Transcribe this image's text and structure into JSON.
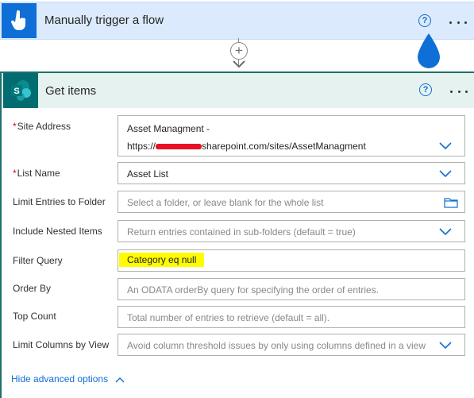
{
  "trigger": {
    "title": "Manually trigger a flow",
    "help": "?",
    "icon": "hand-touch-icon",
    "color": "#0f6fd6"
  },
  "action": {
    "title": "Get items",
    "help": "?",
    "icon": "sharepoint-icon",
    "color": "#036c70"
  },
  "fields": {
    "site_address": {
      "label": "Site Address",
      "required": "*",
      "value_line1": "Asset Managment -",
      "value_line2": "https://",
      "value_line2_tail": "sharepoint.com/sites/AssetManagment"
    },
    "list_name": {
      "label": "List Name",
      "required": "*",
      "value": "Asset List"
    },
    "limit_folder": {
      "label": "Limit Entries to Folder",
      "placeholder": "Select a folder, or leave blank for the whole list"
    },
    "nested_items": {
      "label": "Include Nested Items",
      "placeholder": "Return entries contained in sub-folders (default = true)"
    },
    "filter_query": {
      "label": "Filter Query",
      "value": "Category eq null",
      "highlight": "#fffb00"
    },
    "order_by": {
      "label": "Order By",
      "placeholder": "An ODATA orderBy query for specifying the order of entries."
    },
    "top_count": {
      "label": "Top Count",
      "placeholder": "Total number of entries to retrieve (default = all)."
    },
    "limit_columns": {
      "label": "Limit Columns by View",
      "placeholder": "Avoid column threshold issues by only using columns defined in a view"
    }
  },
  "advanced_link": "Hide advanced options"
}
